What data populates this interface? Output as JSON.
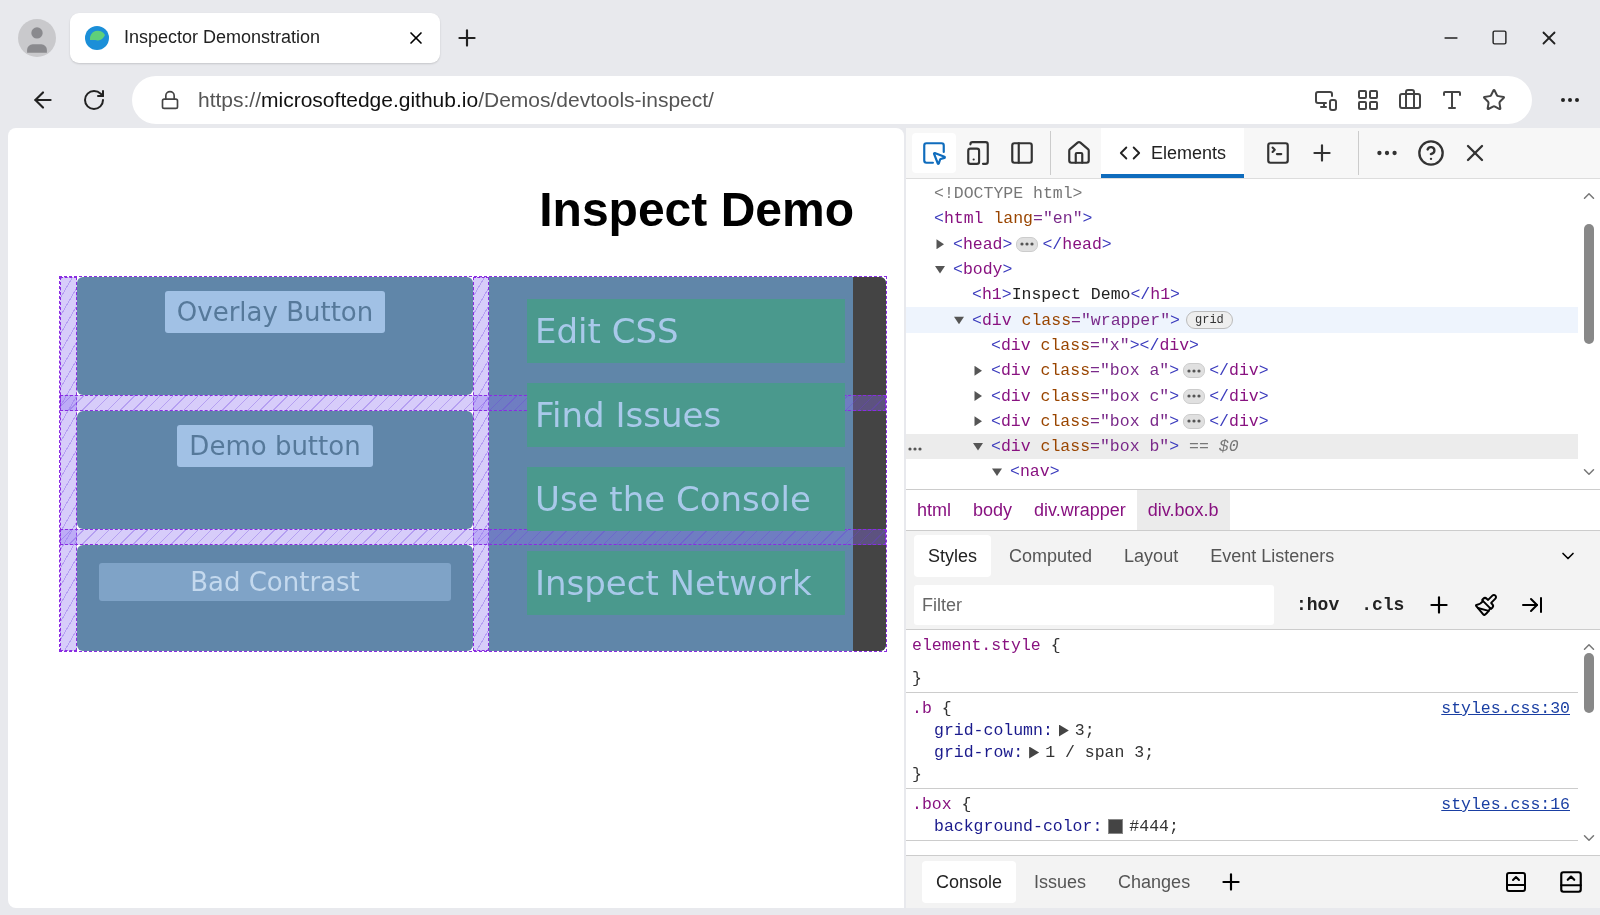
{
  "browser": {
    "tab_title": "Inspector Demonstration",
    "url": {
      "scheme": "https://",
      "host": "microsoftedge.github.io",
      "path": "/Demos/devtools-inspect/"
    }
  },
  "page": {
    "heading": "Inspect Demo",
    "boxes": [
      {
        "label": "Overlay Button",
        "kind": "button"
      },
      {
        "label": "Demo button",
        "kind": "button"
      },
      {
        "label": "Bad Contrast",
        "kind": "low-contrast"
      }
    ],
    "nav_links": [
      "Edit CSS",
      "Find Issues",
      "Use the Console",
      "Inspect Network"
    ]
  },
  "devtools": {
    "inspect_on": true,
    "tabs": [
      {
        "label": "Elements",
        "selected": true
      }
    ],
    "dom_tree": [
      {
        "tokens": [
          {
            "kind": "dim",
            "s": "<!DOCTYPE html>"
          }
        ],
        "selected": false,
        "hovered": false
      },
      {
        "tokens": [
          {
            "kind": "br",
            "s": "<"
          },
          {
            "kind": "tag",
            "s": "html"
          },
          {
            "kind": "attr",
            "s": " lang"
          },
          {
            "kind": "val",
            "s": "=\"en\""
          },
          {
            "kind": "br",
            "s": ">"
          }
        ],
        "selected": false,
        "hovered": false,
        "children": [
          {
            "tokens": [
              {
                "kind": "br",
                "s": "<"
              },
              {
                "kind": "tag",
                "s": "head"
              },
              {
                "kind": "br",
                "s": ">"
              }
            ],
            "ellipsis": true,
            "closing": [
              {
                "kind": "br",
                "s": "</"
              },
              {
                "kind": "tag",
                "s": "head"
              },
              {
                "kind": "br",
                "s": ">"
              }
            ],
            "expanded": false,
            "selected": false,
            "hovered": false
          },
          {
            "tokens": [
              {
                "kind": "br",
                "s": "<"
              },
              {
                "kind": "tag",
                "s": "body"
              },
              {
                "kind": "br",
                "s": ">"
              }
            ],
            "expanded": true,
            "selected": false,
            "hovered": false,
            "children": [
              {
                "tokens": [
                  {
                    "kind": "br",
                    "s": "<"
                  },
                  {
                    "kind": "tag",
                    "s": "h1"
                  },
                  {
                    "kind": "br",
                    "s": ">"
                  },
                  {
                    "kind": "text",
                    "s": "Inspect Demo"
                  },
                  {
                    "kind": "br",
                    "s": "</"
                  },
                  {
                    "kind": "tag",
                    "s": "h1"
                  },
                  {
                    "kind": "br",
                    "s": ">"
                  }
                ],
                "selected": false,
                "hovered": false
              },
              {
                "tokens": [
                  {
                    "kind": "br",
                    "s": "<"
                  },
                  {
                    "kind": "tag",
                    "s": "div"
                  },
                  {
                    "kind": "attr",
                    "s": " class"
                  },
                  {
                    "kind": "val",
                    "s": "=\"wrapper\""
                  },
                  {
                    "kind": "br",
                    "s": ">"
                  }
                ],
                "badge": "grid",
                "expanded": true,
                "selected": false,
                "hovered": true,
                "children": [
                  {
                    "tokens": [
                      {
                        "kind": "br",
                        "s": "<"
                      },
                      {
                        "kind": "tag",
                        "s": "div"
                      },
                      {
                        "kind": "attr",
                        "s": " class"
                      },
                      {
                        "kind": "val",
                        "s": "=\"x\""
                      },
                      {
                        "kind": "br",
                        "s": "></"
                      },
                      {
                        "kind": "tag",
                        "s": "div"
                      },
                      {
                        "kind": "br",
                        "s": ">"
                      }
                    ],
                    "selected": false,
                    "hovered": false
                  },
                  {
                    "tokens": [
                      {
                        "kind": "br",
                        "s": "<"
                      },
                      {
                        "kind": "tag",
                        "s": "div"
                      },
                      {
                        "kind": "attr",
                        "s": " class"
                      },
                      {
                        "kind": "val",
                        "s": "=\"box a\""
                      },
                      {
                        "kind": "br",
                        "s": ">"
                      }
                    ],
                    "ellipsis": true,
                    "closing": [
                      {
                        "kind": "br",
                        "s": "</"
                      },
                      {
                        "kind": "tag",
                        "s": "div"
                      },
                      {
                        "kind": "br",
                        "s": ">"
                      }
                    ],
                    "expanded": false,
                    "selected": false,
                    "hovered": false
                  },
                  {
                    "tokens": [
                      {
                        "kind": "br",
                        "s": "<"
                      },
                      {
                        "kind": "tag",
                        "s": "div"
                      },
                      {
                        "kind": "attr",
                        "s": " class"
                      },
                      {
                        "kind": "val",
                        "s": "=\"box c\""
                      },
                      {
                        "kind": "br",
                        "s": ">"
                      }
                    ],
                    "ellipsis": true,
                    "closing": [
                      {
                        "kind": "br",
                        "s": "</"
                      },
                      {
                        "kind": "tag",
                        "s": "div"
                      },
                      {
                        "kind": "br",
                        "s": ">"
                      }
                    ],
                    "expanded": false,
                    "selected": false,
                    "hovered": false
                  },
                  {
                    "tokens": [
                      {
                        "kind": "br",
                        "s": "<"
                      },
                      {
                        "kind": "tag",
                        "s": "div"
                      },
                      {
                        "kind": "attr",
                        "s": " class"
                      },
                      {
                        "kind": "val",
                        "s": "=\"box d\""
                      },
                      {
                        "kind": "br",
                        "s": ">"
                      }
                    ],
                    "ellipsis": true,
                    "closing": [
                      {
                        "kind": "br",
                        "s": "</"
                      },
                      {
                        "kind": "tag",
                        "s": "div"
                      },
                      {
                        "kind": "br",
                        "s": ">"
                      }
                    ],
                    "expanded": false,
                    "selected": false,
                    "hovered": false
                  },
                  {
                    "tokens": [
                      {
                        "kind": "br",
                        "s": "<"
                      },
                      {
                        "kind": "tag",
                        "s": "div"
                      },
                      {
                        "kind": "attr",
                        "s": " class"
                      },
                      {
                        "kind": "val",
                        "s": "=\"box b\""
                      },
                      {
                        "kind": "br",
                        "s": ">"
                      },
                      {
                        "kind": "dim",
                        "s": " == $0"
                      }
                    ],
                    "expanded": true,
                    "selected": true,
                    "hovered": false,
                    "children": [
                      {
                        "tokens": [
                          {
                            "kind": "br",
                            "s": "<"
                          },
                          {
                            "kind": "tag",
                            "s": "nav"
                          },
                          {
                            "kind": "br",
                            "s": ">"
                          }
                        ],
                        "expanded": true,
                        "selected": false,
                        "hovered": false
                      }
                    ]
                  }
                ]
              }
            ]
          }
        ]
      }
    ],
    "breadcrumbs": [
      {
        "label": "html",
        "selected": false
      },
      {
        "label": "body",
        "selected": false
      },
      {
        "label": "div.wrapper",
        "selected": false
      },
      {
        "label": "div.box.b",
        "selected": true
      }
    ],
    "pane_tabs": [
      {
        "label": "Styles",
        "selected": true
      },
      {
        "label": "Computed",
        "selected": false
      },
      {
        "label": "Layout",
        "selected": false
      },
      {
        "label": "Event Listeners",
        "selected": false
      }
    ],
    "filter": {
      "placeholder": "Filter"
    },
    "style_buttons": [
      ":hov",
      ".cls"
    ],
    "rules": [
      {
        "selector": "element.style",
        "open": "{",
        "close": "}"
      },
      {
        "selector": ".b",
        "open": "{",
        "close": "}",
        "source": "styles.css:30",
        "properties": [
          {
            "name": "grid-column:",
            "value": "3;",
            "expandable": true
          },
          {
            "name": "grid-row:",
            "value": "1 / span 3;",
            "expandable": true
          }
        ]
      },
      {
        "selector": ".box",
        "open": "{",
        "source": "styles.css:16",
        "properties": [
          {
            "name": "background-color:",
            "value": "#444;",
            "color": "#444444"
          }
        ]
      }
    ],
    "drawer_tabs": [
      {
        "label": "Console",
        "selected": true
      },
      {
        "label": "Issues",
        "selected": false
      },
      {
        "label": "Changes",
        "selected": false
      }
    ]
  }
}
